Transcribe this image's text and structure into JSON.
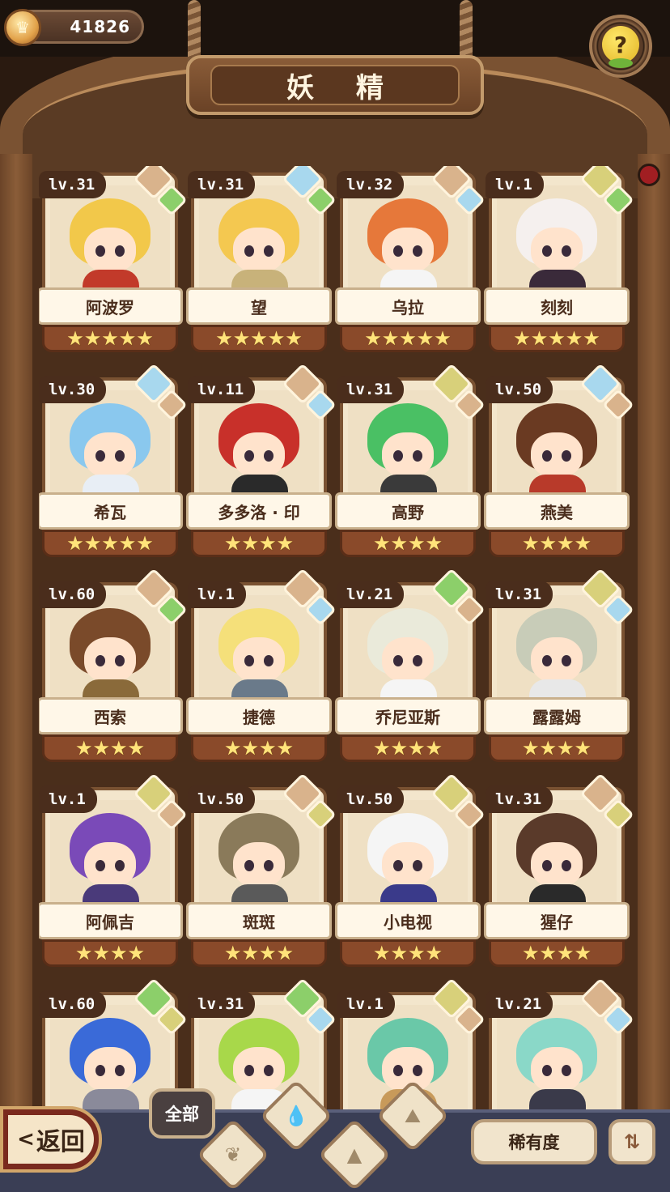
{
  "currency": {
    "value": "41826",
    "icon": "crown-coin-icon"
  },
  "header": {
    "title": "妖 精",
    "help_label": "?"
  },
  "cards": [
    {
      "level": "lv.31",
      "name": "阿波罗",
      "stars": "★★★★★",
      "hair": "#f2c84a",
      "body": "#c23a2a",
      "gems": [
        "#d9b38c",
        "#8ccf6a"
      ]
    },
    {
      "level": "lv.31",
      "name": "望",
      "stars": "★★★★★",
      "hair": "#f4c850",
      "body": "#c8b27a",
      "gems": [
        "#a8d8ee",
        "#8ccf6a"
      ]
    },
    {
      "level": "lv.32",
      "name": "乌拉",
      "stars": "★★★★★",
      "hair": "#e6783a",
      "body": "#f5f5f5",
      "gems": [
        "#d9b38c",
        "#a8d8ee"
      ]
    },
    {
      "level": "lv.1",
      "name": "刻刻",
      "stars": "★★★★★",
      "hair": "#f5f0ee",
      "body": "#3a2a3a",
      "gems": [
        "#d8d07a",
        "#8ccf6a"
      ]
    },
    {
      "level": "lv.30",
      "name": "希瓦",
      "stars": "★★★★★",
      "hair": "#8ac8ee",
      "body": "#e8eef5",
      "gems": [
        "#a8d8ee",
        "#d9b38c"
      ]
    },
    {
      "level": "lv.11",
      "name": "多多洛 · 印",
      "stars": "★★★★",
      "hair": "#c8302a",
      "body": "#2a2a2a",
      "gems": [
        "#d9b38c",
        "#a8d8ee"
      ]
    },
    {
      "level": "lv.31",
      "name": "高野",
      "stars": "★★★★",
      "hair": "#4ac064",
      "body": "#3a3a3a",
      "gems": [
        "#d8d07a",
        "#d9b38c"
      ]
    },
    {
      "level": "lv.50",
      "name": "燕美",
      "stars": "★★★★",
      "hair": "#6a3a22",
      "body": "#b83a2a",
      "gems": [
        "#a8d8ee",
        "#d9b38c"
      ]
    },
    {
      "level": "lv.60",
      "name": "西索",
      "stars": "★★★★",
      "hair": "#7a4a2a",
      "body": "#8a6a3a",
      "gems": [
        "#d9b38c",
        "#8ccf6a"
      ]
    },
    {
      "level": "lv.1",
      "name": "捷德",
      "stars": "★★★★",
      "hair": "#f5e07a",
      "body": "#6a7a8a",
      "gems": [
        "#d9b38c",
        "#a8d8ee"
      ]
    },
    {
      "level": "lv.21",
      "name": "乔尼亚斯",
      "stars": "★★★★",
      "hair": "#eaeada",
      "body": "#f5f5f5",
      "gems": [
        "#8ccf6a",
        "#d9b38c"
      ]
    },
    {
      "level": "lv.31",
      "name": "露露姆",
      "stars": "★★★★",
      "hair": "#c8ccb8",
      "body": "#e8e8e8",
      "gems": [
        "#d8d07a",
        "#a8d8ee"
      ]
    },
    {
      "level": "lv.1",
      "name": "阿佩吉",
      "stars": "★★★★",
      "hair": "#7a4ab8",
      "body": "#4a3a7a",
      "gems": [
        "#d8d07a",
        "#d9b38c"
      ]
    },
    {
      "level": "lv.50",
      "name": "斑斑",
      "stars": "★★★★",
      "hair": "#8a7a5a",
      "body": "#5a5a5a",
      "gems": [
        "#d9b38c",
        "#d8d07a"
      ]
    },
    {
      "level": "lv.50",
      "name": "小电视",
      "stars": "★★★★",
      "hair": "#f5f5f5",
      "body": "#3a3a8a",
      "gems": [
        "#d8d07a",
        "#d9b38c"
      ]
    },
    {
      "level": "lv.31",
      "name": "猩仔",
      "stars": "★★★★",
      "hair": "#5a3a2a",
      "body": "#2a2a2a",
      "gems": [
        "#d9b38c",
        "#d8d07a"
      ]
    },
    {
      "level": "lv.60",
      "name": "",
      "stars": "",
      "hair": "#3a6ad8",
      "body": "#8a8a9a",
      "gems": [
        "#8ccf6a",
        "#d8d07a"
      ]
    },
    {
      "level": "lv.31",
      "name": "",
      "stars": "",
      "hair": "#a8d84a",
      "body": "#f5f5f5",
      "gems": [
        "#8ccf6a",
        "#a8d8ee"
      ]
    },
    {
      "level": "lv.1",
      "name": "",
      "stars": "",
      "hair": "#6ac8a8",
      "body": "#c89a5a",
      "gems": [
        "#d8d07a",
        "#d9b38c"
      ]
    },
    {
      "level": "lv.21",
      "name": "",
      "stars": "",
      "hair": "#8ad8c8",
      "body": "#3a3a4a",
      "gems": [
        "#d9b38c",
        "#a8d8ee"
      ]
    }
  ],
  "bottom": {
    "back_arrow": "<",
    "back_label": "返回",
    "filter_all_label": "全部",
    "filters": [
      {
        "icon": "sprout-icon",
        "glyph": "❦"
      },
      {
        "icon": "water-drop-icon",
        "glyph": "💧"
      },
      {
        "icon": "rock-icon",
        "glyph": "▲"
      },
      {
        "icon": "mountain-icon",
        "glyph": "⛰"
      }
    ],
    "sort_label": "稀有度",
    "order_icon": "sort-order-icon",
    "order_glyph": "⇅"
  },
  "colors": {
    "wood": "#7a5232",
    "parchment": "#f3e6cc",
    "star": "#ffe37a",
    "bottom_bar": "#3a3e55"
  }
}
